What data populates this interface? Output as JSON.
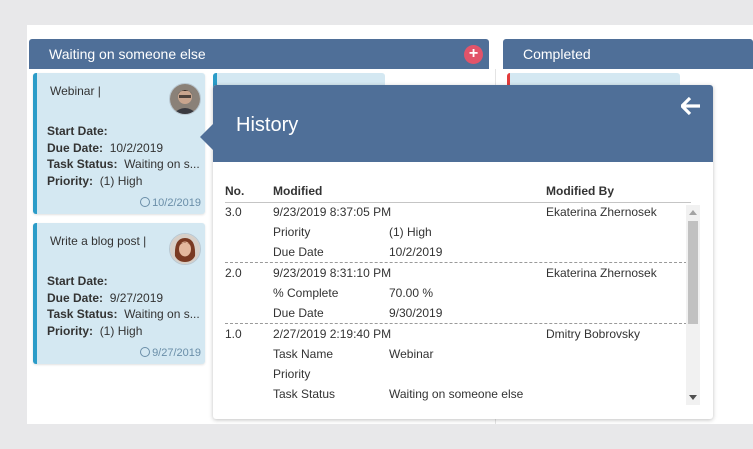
{
  "columns": [
    {
      "title": "Waiting on someone else",
      "add_label": "+"
    },
    {
      "title": "Completed"
    }
  ],
  "cards": [
    {
      "name": "Webinar |",
      "start_label": "Start Date:",
      "due_label": "Due Date:",
      "due_value": "10/2/2019",
      "status_label": "Task Status:",
      "status_value": "Waiting on s...",
      "priority_label": "Priority:",
      "priority_value": "(1) High",
      "footer_date": "10/2/2019"
    },
    {
      "name": "Write a blog post |",
      "start_label": "Start Date:",
      "due_label": "Due Date:",
      "due_value": "9/27/2019",
      "status_label": "Task Status:",
      "status_value": "Waiting on s...",
      "priority_label": "Priority:",
      "priority_value": "(1) High",
      "footer_date": "9/27/2019"
    }
  ],
  "history": {
    "title": "History",
    "columns": {
      "no": "No.",
      "modified": "Modified",
      "by": "Modified By"
    },
    "revisions": [
      {
        "no": "3.0",
        "datetime": "9/23/2019 8:37:05 PM",
        "by": "Ekaterina Zhernosek",
        "changes": [
          {
            "field": "Priority",
            "value": "(1) High"
          },
          {
            "field": "Due Date",
            "value": "10/2/2019"
          }
        ]
      },
      {
        "no": "2.0",
        "datetime": "9/23/2019 8:31:10 PM",
        "by": "Ekaterina Zhernosek",
        "changes": [
          {
            "field": "% Complete",
            "value": "70.00 %"
          },
          {
            "field": "Due Date",
            "value": "9/30/2019"
          }
        ]
      },
      {
        "no": "1.0",
        "datetime": "2/27/2019 2:19:40 PM",
        "by": "Dmitry Bobrovsky",
        "changes": [
          {
            "field": "Task Name",
            "value": "Webinar"
          },
          {
            "field": "Priority",
            "value": ""
          },
          {
            "field": "Task Status",
            "value": "Waiting on someone else"
          }
        ]
      }
    ]
  },
  "colors": {
    "header": "#4f6f98",
    "card": "#d4e8f2",
    "card_accent": "#2b9cc8",
    "add_button": "#e2546a",
    "completed_accent": "#e23b3b"
  },
  "icons": {
    "add": "plus-icon",
    "back": "arrow-left-icon",
    "clock": "clock-icon"
  }
}
